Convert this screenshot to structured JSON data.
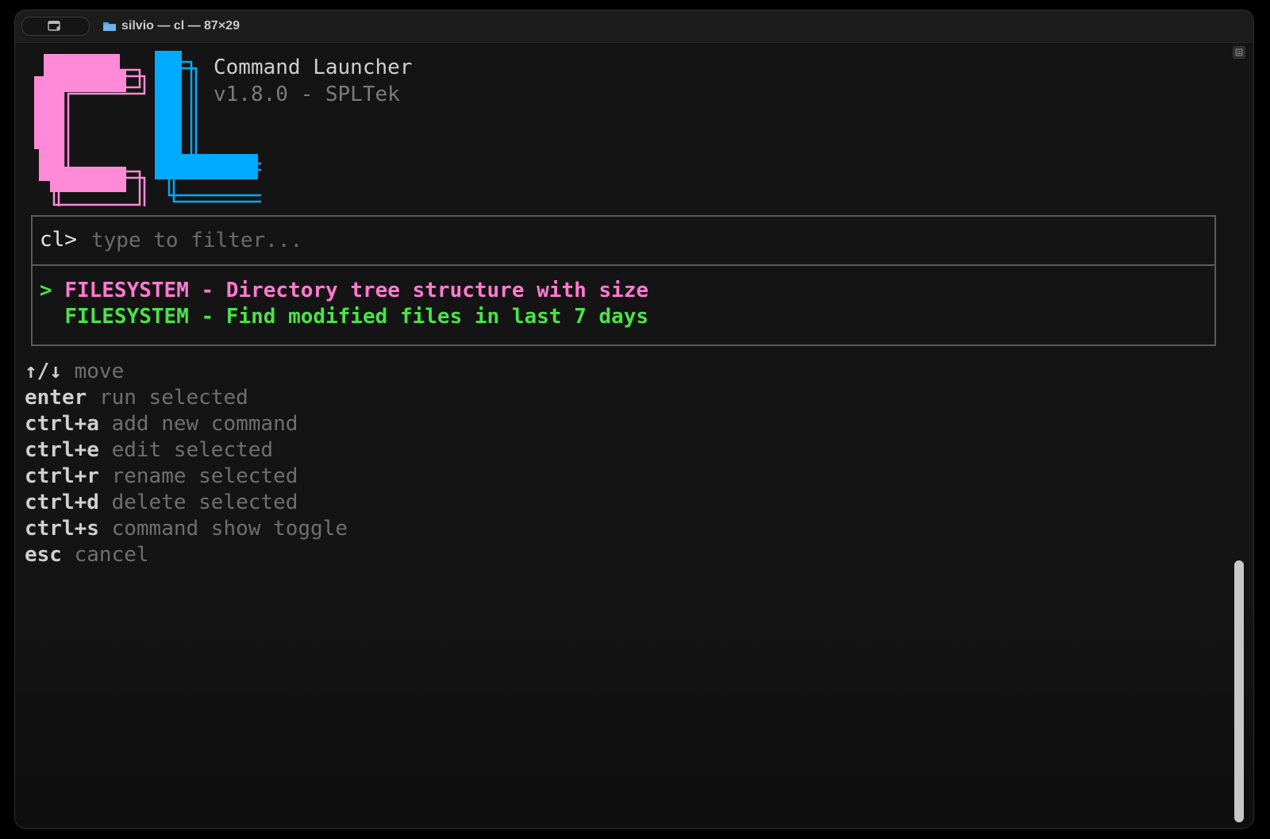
{
  "window": {
    "title": "silvio — cl — 87×29",
    "folder_icon": "folder-icon",
    "tab_icon": "terminal-tab-icon"
  },
  "app": {
    "logo_letters": "CL",
    "name": "Command Launcher",
    "version": "v1.8.0 - SPLTek",
    "colors": {
      "logo_c": "#ff8ad8",
      "logo_l": "#00aaff",
      "selected": "#ff7ad1",
      "normal": "#4be24b"
    }
  },
  "filter": {
    "prompt": "cl>",
    "placeholder": "type to filter...",
    "value": ""
  },
  "results": {
    "cursor": ">",
    "items": [
      {
        "label": "FILESYSTEM - Directory tree structure with size",
        "selected": true
      },
      {
        "label": "FILESYSTEM - Find modified files in last 7 days",
        "selected": false
      }
    ]
  },
  "shortcuts": [
    {
      "key": "↑/↓",
      "desc": "move"
    },
    {
      "key": "enter",
      "desc": "run selected"
    },
    {
      "key": "ctrl+a",
      "desc": "add new command"
    },
    {
      "key": "ctrl+e",
      "desc": "edit selected"
    },
    {
      "key": "ctrl+r",
      "desc": "rename selected"
    },
    {
      "key": "ctrl+d",
      "desc": "delete selected"
    },
    {
      "key": "ctrl+s",
      "desc": "command show toggle"
    },
    {
      "key": "esc",
      "desc": "cancel"
    }
  ]
}
